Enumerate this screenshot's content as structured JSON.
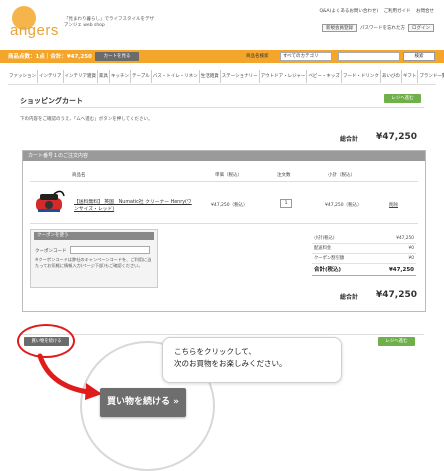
{
  "header": {
    "logo_text": "angers",
    "tagline_line1": "「見まわり暮らし」でライフスタイルをデザ",
    "tagline_line2": "アンジェ web shop",
    "toplinks": [
      "Q&A(よくあるお問い合わせ)",
      "ご利用ガイド",
      "お問合せ"
    ],
    "register_label": "新規会員登録",
    "password_label": "パスワードを忘れた方",
    "login_label": "ログイン"
  },
  "bar": {
    "cart_info": "商品点数：1点｜合計：¥47,250",
    "cart_button": "カートを見る",
    "search_label": "商品名検索",
    "search_select": "すべてのカテゴリ",
    "search_button": "検索"
  },
  "categories": [
    "ファッション",
    "インテリア",
    "インテリア雑貨",
    "家具",
    "キッチン",
    "テーブル",
    "バス・トイレ・リネン",
    "生活雑貨",
    "ステーショナリー",
    "アウトドア・レジャー",
    "ベビー・キッズ",
    "フード・ドリンク",
    "あいびの",
    "ギフト",
    "ブランド一覧"
  ],
  "page": {
    "title": "ショッピングカート",
    "back_button": "レジへ進む",
    "intro": "下の内容をご確認のうえ、「ムへ進む」ボタンを押してください。",
    "grand_total_label": "総合計",
    "grand_total_value": "¥47,250"
  },
  "cart": {
    "header": "カート番号１のご注文内容",
    "columns": [
      "商品名",
      "単価（税込）",
      "注文数",
      "小計（税込）"
    ],
    "item": {
      "name": "【送料無料】 英国　Numatic社 クリーナー Henry(ワンサイズ・レッド)",
      "price": "¥47,250（税込）",
      "qty": "1",
      "subtotal": "¥47,250（税込）",
      "delete_label": "削除"
    }
  },
  "coupon": {
    "title": "クーポンを使う",
    "label": "クーポンコード",
    "note": "※クーポンコードは弊社のキャンペーンコードを、ご利用に当たってお気軽に情報入力(ページ下部)もご確認ください。"
  },
  "summary": {
    "rows": [
      {
        "label": "小計(税込)",
        "value": "¥47,250"
      },
      {
        "label": "配送料金",
        "value": "¥0"
      },
      {
        "label": "クーポン割引額",
        "value": "¥0"
      }
    ],
    "total_label": "合計(税込)",
    "total_value": "¥47,250"
  },
  "bottom": {
    "grand_total_label": "総合計",
    "grand_total_value": "¥47,250",
    "continue_small": "買い物を続ける",
    "back_button": "レジへ進む",
    "continue_big": "買い物を続ける »",
    "bubble_line1": "こちらをクリックして、",
    "bubble_line2": "次のお買物をお楽しみください。"
  },
  "colors": {
    "brand_orange": "#f3a52c",
    "button_gray": "#6b6b6b",
    "button_green": "#6fb04a",
    "highlight_red": "#e01b1b"
  }
}
